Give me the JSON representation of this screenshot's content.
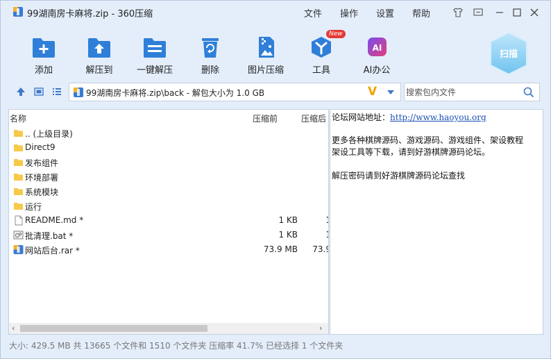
{
  "window": {
    "title": "99湖南房卡麻将.zip - 360压缩",
    "menu": [
      "文件",
      "操作",
      "设置",
      "帮助"
    ]
  },
  "toolbar": {
    "items": [
      {
        "label": "添加",
        "icon": "add-folder-icon"
      },
      {
        "label": "解压到",
        "icon": "extract-to-icon"
      },
      {
        "label": "一键解压",
        "icon": "one-click-extract-icon"
      },
      {
        "label": "删除",
        "icon": "trash-icon"
      },
      {
        "label": "图片压缩",
        "icon": "image-compress-icon"
      },
      {
        "label": "工具",
        "icon": "tools-icon",
        "badge": "New"
      },
      {
        "label": "AI办公",
        "icon": "ai-office-icon",
        "icon_text": "AI"
      }
    ],
    "scan_label": "扫描"
  },
  "address": {
    "path": "99湖南房卡麻将.zip\\back - 解包大小为 1.0 GB",
    "v_mark": "V"
  },
  "search": {
    "placeholder": "搜索包内文件"
  },
  "filelist": {
    "columns": [
      "名称",
      "压缩前",
      "压缩后"
    ],
    "rows": [
      {
        "name": ".. (上级目录)",
        "size": "",
        "packed": "",
        "type": "folder"
      },
      {
        "name": "Direct9",
        "size": "",
        "packed": "",
        "type": "folder"
      },
      {
        "name": "发布组件",
        "size": "",
        "packed": "",
        "type": "folder"
      },
      {
        "name": "环境部署",
        "size": "",
        "packed": "",
        "type": "folder"
      },
      {
        "name": "系统模块",
        "size": "",
        "packed": "",
        "type": "folder"
      },
      {
        "name": "运行",
        "size": "",
        "packed": "",
        "type": "folder"
      },
      {
        "name": "README.md *",
        "size": "1 KB",
        "packed": "1",
        "type": "doc"
      },
      {
        "name": "批清理.bat *",
        "size": "1 KB",
        "packed": "1",
        "type": "bat"
      },
      {
        "name": "网站后台.rar *",
        "size": "73.9 MB",
        "packed": "73.9",
        "type": "rar"
      }
    ]
  },
  "preview": {
    "line1_label": "论坛网站地址：",
    "line1_link": "http://www.haoyou.org",
    "line2": "更多各种棋牌源码、游戏源码、游戏组件、架设教程",
    "line3": "架设工具等下载，请到好游棋牌源码论坛。",
    "line4": "解压密码请到好游棋牌源码论坛查找"
  },
  "status": {
    "text": "大小: 429.5 MB 共 13665 个文件和 1510 个文件夹 压缩率 41.7% 已经选择 1 个文件夹"
  },
  "colors": {
    "accent": "#2f7fd8",
    "window_bg": "#e4eefb",
    "folder": "#f7c948",
    "badge": "#e53935"
  }
}
